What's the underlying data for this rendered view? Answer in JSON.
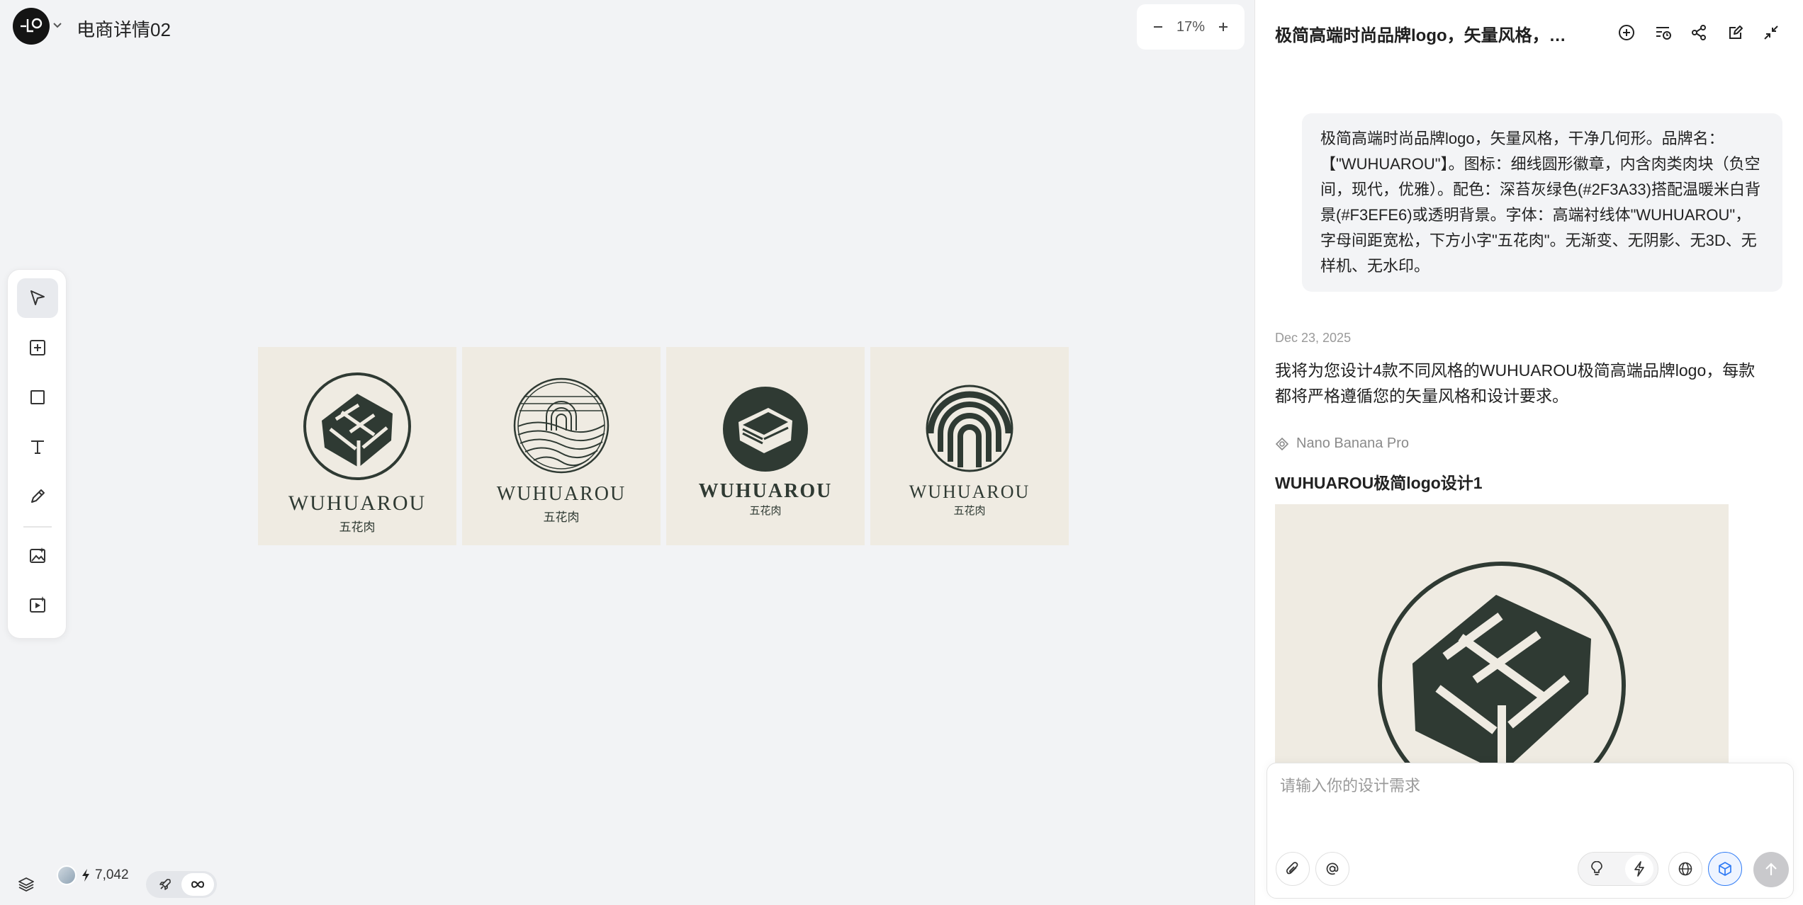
{
  "header": {
    "project_title": "电商详情02"
  },
  "zoom": {
    "level": "17%"
  },
  "toolbar": {
    "tools": [
      "select",
      "add-frame",
      "rectangle",
      "text",
      "pen",
      "image-generate",
      "video-generate"
    ]
  },
  "canvas": {
    "cards": [
      {
        "brand": "WUHUAROU",
        "sub": "五花肉"
      },
      {
        "brand": "WUHUAROU",
        "sub": "五花肉"
      },
      {
        "brand": "WUHUAROU",
        "sub": "五花肉"
      },
      {
        "brand": "WUHUAROU",
        "sub": "五花肉"
      }
    ]
  },
  "status": {
    "credits": "7,042"
  },
  "chat": {
    "title": "极简高端时尚品牌logo，矢量风格，干净...",
    "user_prompt": "极简高端时尚品牌logo，矢量风格，干净几何形。品牌名：【\"WUHUAROU\"】。图标：细线圆形徽章，内含肉类肉块（负空间，现代，优雅）。配色：深苔灰绿色(#2F3A33)搭配温暖米白背景(#F3EFE6)或透明背景。字体：高端衬线体\"WUHUAROU\"，字母间距宽松，下方小字\"五花肉\"。无渐变、无阴影、无3D、无样机、无水印。",
    "date": "Dec 23, 2025",
    "ai_reply": "我将为您设计4款不同风格的WUHUAROU极简高端品牌logo，每款都将严格遵循您的矢量风格和设计要求。",
    "model": "Nano Banana Pro",
    "result_title": "WUHUAROU极简logo设计1",
    "input_placeholder": "请输入你的设计需求"
  },
  "colors": {
    "logo_green": "#2F3A33",
    "logo_bg": "#EFEBE2",
    "accent_blue": "#2F7BF5"
  }
}
